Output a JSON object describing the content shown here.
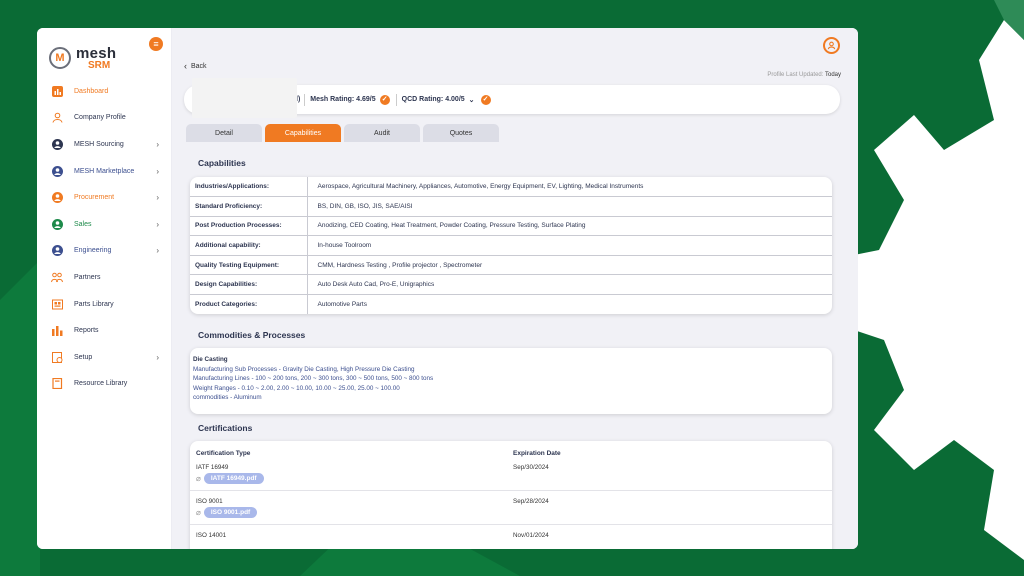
{
  "logo": {
    "line1": "mesh",
    "line2": "SRM",
    "mark": "M"
  },
  "nav": [
    {
      "label": "Dashboard",
      "icon": "bar-chart-icon",
      "color": "orange",
      "chevron": false
    },
    {
      "label": "Company Profile",
      "icon": "user-icon",
      "color": "default",
      "chevron": false
    },
    {
      "label": "MESH Sourcing",
      "icon": "user-circle-icon",
      "color": "default",
      "chevron": true
    },
    {
      "label": "MESH Marketplace",
      "icon": "user-circle-icon",
      "color": "blue",
      "chevron": true
    },
    {
      "label": "Procurement",
      "icon": "user-circle-icon",
      "color": "orange",
      "chevron": true
    },
    {
      "label": "Sales",
      "icon": "user-circle-icon",
      "color": "green",
      "chevron": true
    },
    {
      "label": "Engineering",
      "icon": "user-circle-icon",
      "color": "blue",
      "chevron": true
    },
    {
      "label": "Partners",
      "icon": "people-icon",
      "color": "default",
      "chevron": false
    },
    {
      "label": "Parts Library",
      "icon": "parts-icon",
      "color": "default",
      "chevron": false
    },
    {
      "label": "Reports",
      "icon": "reports-icon",
      "color": "default",
      "chevron": false
    },
    {
      "label": "Setup",
      "icon": "setup-icon",
      "color": "default",
      "chevron": true
    },
    {
      "label": "Resource Library",
      "icon": "book-icon",
      "color": "default",
      "chevron": false
    }
  ],
  "header": {
    "back": "Back",
    "updated_label": "Profile Last Updated:",
    "updated_value": "Today"
  },
  "ratings": {
    "frag": "l)",
    "mesh": "Mesh Rating: 4.69/5",
    "qcd": "QCD Rating: 4.00/5"
  },
  "tabs": [
    "Detail",
    "Capabilities",
    "Audit",
    "Quotes"
  ],
  "active_tab": "Capabilities",
  "capabilities": {
    "title": "Capabilities",
    "rows": [
      {
        "label": "Industries/Applications:",
        "value": "Aerospace, Agricultural Machinery, Appliances, Automotive, Energy Equipment, EV, Lighting, Medical Instruments"
      },
      {
        "label": "Standard Proficiency:",
        "value": "BS, DIN, GB, ISO, JIS, SAE/AISI"
      },
      {
        "label": "Post Production Processes:",
        "value": "Anodizing, CED Coating, Heat Treatment, Powder Coating, Pressure Testing, Surface Plating"
      },
      {
        "label": "Additional capability:",
        "value": "In-house Toolroom"
      },
      {
        "label": "Quality Testing Equipment:",
        "value": "CMM, Hardness Testing , Profile projector , Spectrometer"
      },
      {
        "label": "Design Capabilities:",
        "value": "Auto Desk Auto Cad, Pro-E, Unigraphics"
      },
      {
        "label": "Product Categories:",
        "value": "Automotive Parts"
      }
    ]
  },
  "commodities": {
    "title": "Commodities & Processes",
    "head": "Die Casting",
    "lines": [
      "Manufacturing Sub Processes - Gravity Die Casting, High Pressure Die Casting",
      "Manufacturing Lines - 100 ~ 200 tons, 200 ~ 300 tons, 300 ~ 500 tons, 500 ~ 800 tons",
      "Weight Ranges - 0.10 ~ 2.00, 2.00 ~ 10.00, 10.00 ~ 25.00, 25.00 ~ 100.00",
      "commodities - Aluminum"
    ]
  },
  "certifications": {
    "title": "Certifications",
    "col_type": "Certification Type",
    "col_exp": "Expiration Date",
    "rows": [
      {
        "type": "IATF 16949",
        "file": "IATF 16949.pdf",
        "exp": "Sep/30/2024"
      },
      {
        "type": "ISO 9001",
        "file": "ISO 9001.pdf",
        "exp": "Sep/28/2024"
      },
      {
        "type": "ISO 14001",
        "file": "",
        "exp": "Nov/01/2024"
      }
    ]
  },
  "colors": {
    "accent": "#f07a22",
    "background": "#0a6b35",
    "pill": "#a9b8ea"
  }
}
